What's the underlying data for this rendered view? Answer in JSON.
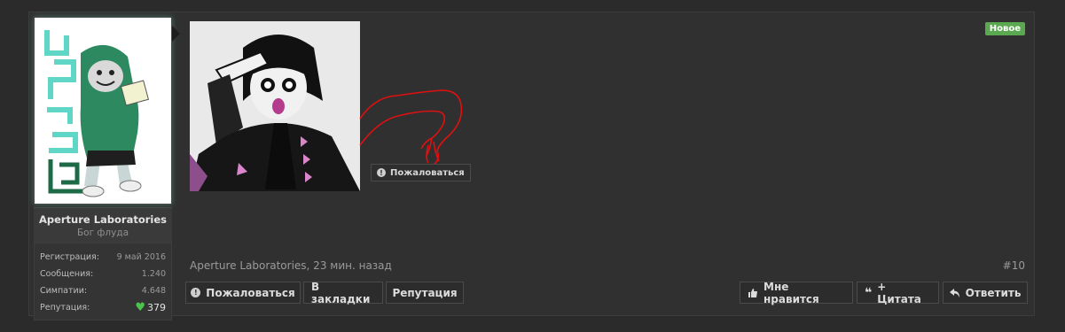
{
  "user": {
    "name": "Aperture Laboratories",
    "title": "Бог флуда",
    "stats": [
      {
        "label": "Регистрация:",
        "value": "9 май 2016"
      },
      {
        "label": "Сообщения:",
        "value": "1.240"
      },
      {
        "label": "Симпатии:",
        "value": "4.648"
      }
    ],
    "reputation_label": "Репутация:",
    "reputation_value": "379"
  },
  "post": {
    "badge": "Новое",
    "image_report_label": "Пожаловаться",
    "meta": "Aperture Laboratories, 23 мин. назад",
    "number": "#10"
  },
  "actions": {
    "report": "Пожаловаться",
    "bookmark": "В закладки",
    "reputation": "Репутация",
    "like": "Мне нравится",
    "quote": "+ Цитата",
    "reply": "Ответить"
  },
  "colors": {
    "background": "#2b2b2b",
    "post_background": "#303030",
    "badge_green": "#5aa84f",
    "heart_green": "#4cc44c",
    "drawing_red": "#e01010"
  }
}
